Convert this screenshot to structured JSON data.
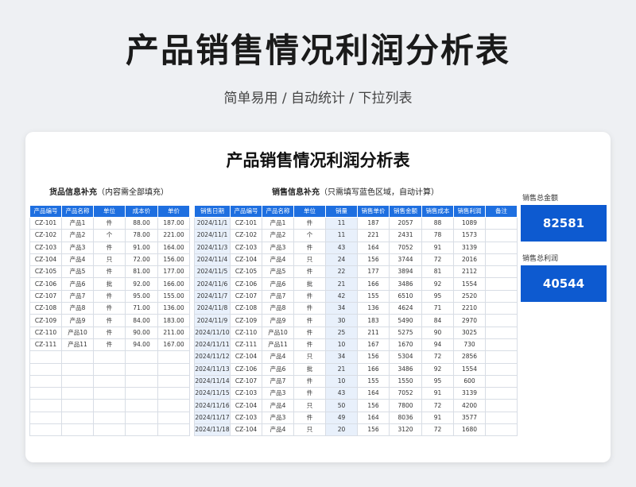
{
  "header": {
    "title": "产品销售情况利润分析表",
    "subtitle": "简单易用 / 自动统计 / 下拉列表"
  },
  "card": {
    "title": "产品销售情况利润分析表"
  },
  "goods_section": {
    "label_bold": "货品信息补充",
    "label_note": "（内容需全部填充）",
    "headers": [
      "产品编号",
      "产品名称",
      "单位",
      "成本价",
      "单价"
    ],
    "rows": [
      [
        "CZ-101",
        "产品1",
        "件",
        "88.00",
        "187.00"
      ],
      [
        "CZ-102",
        "产品2",
        "个",
        "78.00",
        "221.00"
      ],
      [
        "CZ-103",
        "产品3",
        "件",
        "91.00",
        "164.00"
      ],
      [
        "CZ-104",
        "产品4",
        "只",
        "72.00",
        "156.00"
      ],
      [
        "CZ-105",
        "产品5",
        "件",
        "81.00",
        "177.00"
      ],
      [
        "CZ-106",
        "产品6",
        "批",
        "92.00",
        "166.00"
      ],
      [
        "CZ-107",
        "产品7",
        "件",
        "95.00",
        "155.00"
      ],
      [
        "CZ-108",
        "产品8",
        "件",
        "71.00",
        "136.00"
      ],
      [
        "CZ-109",
        "产品9",
        "件",
        "84.00",
        "183.00"
      ],
      [
        "CZ-110",
        "产品10",
        "件",
        "90.00",
        "211.00"
      ],
      [
        "CZ-111",
        "产品11",
        "件",
        "94.00",
        "167.00"
      ],
      [
        "",
        "",
        "",
        "",
        ""
      ],
      [
        "",
        "",
        "",
        "",
        ""
      ],
      [
        "",
        "",
        "",
        "",
        ""
      ],
      [
        "",
        "",
        "",
        "",
        ""
      ],
      [
        "",
        "",
        "",
        "",
        ""
      ],
      [
        "",
        "",
        "",
        "",
        ""
      ],
      [
        "",
        "",
        "",
        "",
        ""
      ]
    ]
  },
  "sales_section": {
    "label_bold": "销售信息补充",
    "label_note": "（只需填写蓝色区域，自动计算）",
    "headers": [
      "销售日期",
      "产品编号",
      "产品名称",
      "单位",
      "销量",
      "销售单价",
      "销售金额",
      "销售成本",
      "销售利润",
      "备注"
    ],
    "rows": [
      [
        "2024/11/1",
        "CZ-101",
        "产品1",
        "件",
        "11",
        "187",
        "2057",
        "88",
        "1089",
        ""
      ],
      [
        "2024/11/1",
        "CZ-102",
        "产品2",
        "个",
        "11",
        "221",
        "2431",
        "78",
        "1573",
        ""
      ],
      [
        "2024/11/3",
        "CZ-103",
        "产品3",
        "件",
        "43",
        "164",
        "7052",
        "91",
        "3139",
        ""
      ],
      [
        "2024/11/4",
        "CZ-104",
        "产品4",
        "只",
        "24",
        "156",
        "3744",
        "72",
        "2016",
        ""
      ],
      [
        "2024/11/5",
        "CZ-105",
        "产品5",
        "件",
        "22",
        "177",
        "3894",
        "81",
        "2112",
        ""
      ],
      [
        "2024/11/6",
        "CZ-106",
        "产品6",
        "批",
        "21",
        "166",
        "3486",
        "92",
        "1554",
        ""
      ],
      [
        "2024/11/7",
        "CZ-107",
        "产品7",
        "件",
        "42",
        "155",
        "6510",
        "95",
        "2520",
        ""
      ],
      [
        "2024/11/8",
        "CZ-108",
        "产品8",
        "件",
        "34",
        "136",
        "4624",
        "71",
        "2210",
        ""
      ],
      [
        "2024/11/9",
        "CZ-109",
        "产品9",
        "件",
        "30",
        "183",
        "5490",
        "84",
        "2970",
        ""
      ],
      [
        "2024/11/10",
        "CZ-110",
        "产品10",
        "件",
        "25",
        "211",
        "5275",
        "90",
        "3025",
        ""
      ],
      [
        "2024/11/11",
        "CZ-111",
        "产品11",
        "件",
        "10",
        "167",
        "1670",
        "94",
        "730",
        ""
      ],
      [
        "2024/11/12",
        "CZ-104",
        "产品4",
        "只",
        "34",
        "156",
        "5304",
        "72",
        "2856",
        ""
      ],
      [
        "2024/11/13",
        "CZ-106",
        "产品6",
        "批",
        "21",
        "166",
        "3486",
        "92",
        "1554",
        ""
      ],
      [
        "2024/11/14",
        "CZ-107",
        "产品7",
        "件",
        "10",
        "155",
        "1550",
        "95",
        "600",
        ""
      ],
      [
        "2024/11/15",
        "CZ-103",
        "产品3",
        "件",
        "43",
        "164",
        "7052",
        "91",
        "3139",
        ""
      ],
      [
        "2024/11/16",
        "CZ-104",
        "产品4",
        "只",
        "50",
        "156",
        "7800",
        "72",
        "4200",
        ""
      ],
      [
        "2024/11/17",
        "CZ-103",
        "产品3",
        "件",
        "49",
        "164",
        "8036",
        "91",
        "3577",
        ""
      ],
      [
        "2024/11/18",
        "CZ-104",
        "产品4",
        "只",
        "20",
        "156",
        "3120",
        "72",
        "1680",
        ""
      ]
    ]
  },
  "kpis": [
    {
      "label": "销售总金额",
      "value": "82581"
    },
    {
      "label": "销售总利润",
      "value": "40544"
    }
  ],
  "colors": {
    "header_blue": "#1e6fe0",
    "kpi_blue": "#0d5ad0",
    "input_fill": "#e8f0fb"
  }
}
